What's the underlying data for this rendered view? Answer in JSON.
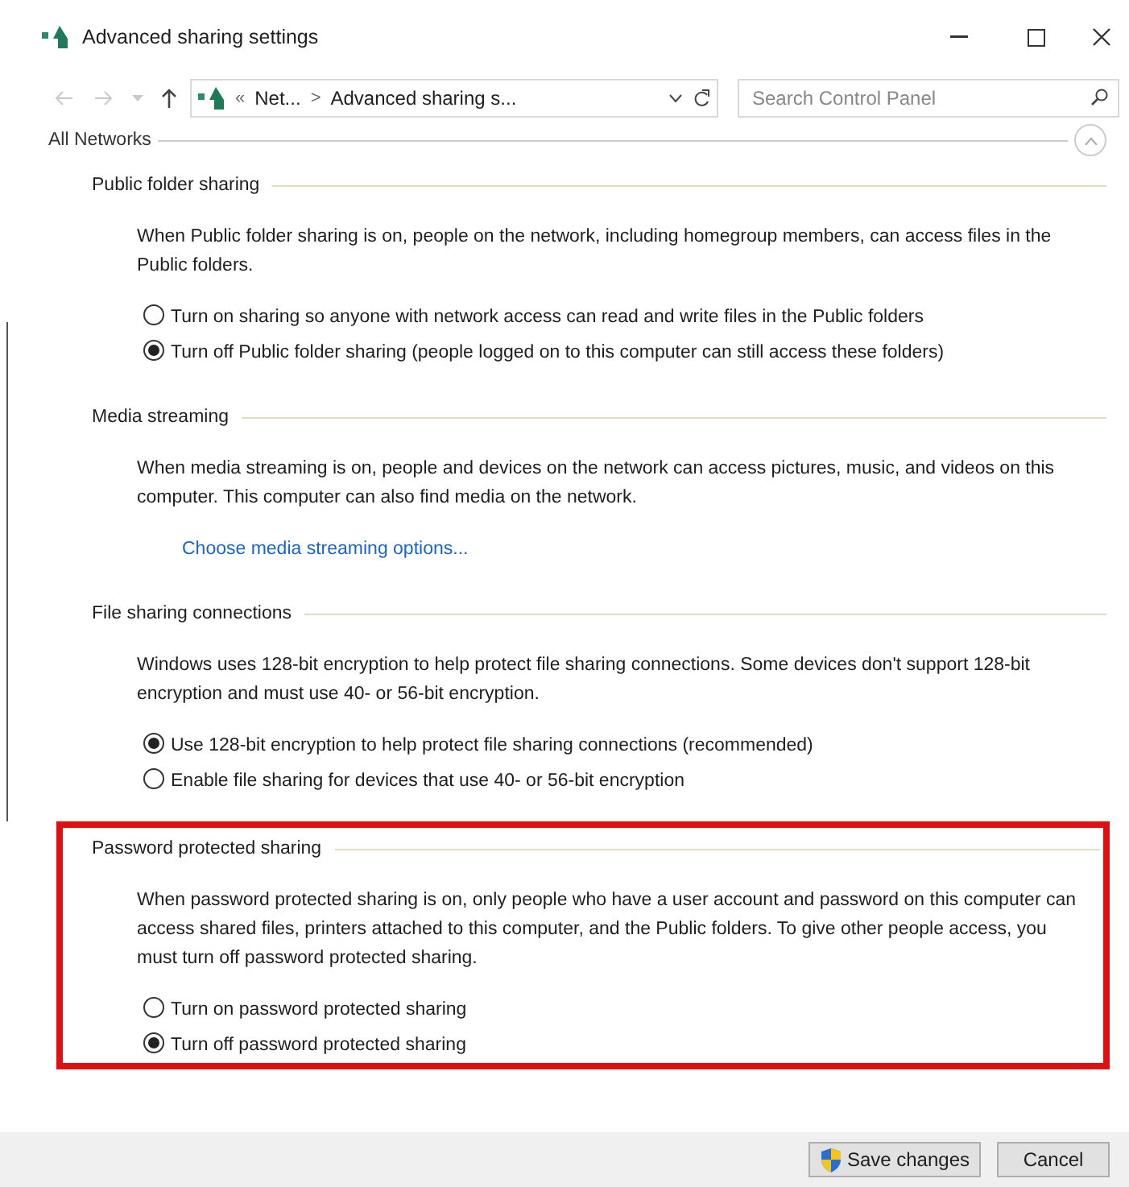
{
  "window": {
    "title": "Advanced sharing settings"
  },
  "address_bar": {
    "overflow": "«",
    "crumbs": [
      "Net...",
      "Advanced sharing s..."
    ],
    "separator": ">"
  },
  "search": {
    "placeholder": "Search Control Panel"
  },
  "group": {
    "title": "All Networks",
    "expanded": true
  },
  "sections": [
    {
      "title": "Public folder sharing",
      "highlighted": false,
      "items": [
        {
          "kind": "text",
          "text": "When Public folder sharing is on, people on the network, including homegroup members, can access files in the Public folders."
        },
        {
          "kind": "radios",
          "options": [
            {
              "label": "Turn on sharing so anyone with network access can read and write files in the Public folders",
              "selected": false
            },
            {
              "label": "Turn off Public folder sharing (people logged on to this computer can still access these folders)",
              "selected": true
            }
          ]
        }
      ]
    },
    {
      "title": "Media streaming",
      "highlighted": false,
      "items": [
        {
          "kind": "text",
          "text": "When media streaming is on, people and devices on the network can access pictures, music, and videos on this computer. This computer can also find media on the network."
        },
        {
          "kind": "link",
          "text": "Choose media streaming options..."
        }
      ]
    },
    {
      "title": "File sharing connections",
      "highlighted": false,
      "items": [
        {
          "kind": "text",
          "text": "Windows uses 128-bit encryption to help protect file sharing connections. Some devices don't support 128-bit encryption and must use 40- or 56-bit encryption."
        },
        {
          "kind": "radios",
          "options": [
            {
              "label": "Use 128-bit encryption to help protect file sharing connections (recommended)",
              "selected": true
            },
            {
              "label": "Enable file sharing for devices that use 40- or 56-bit encryption",
              "selected": false
            }
          ]
        }
      ]
    },
    {
      "title": "Password protected sharing",
      "highlighted": true,
      "items": [
        {
          "kind": "text",
          "text": "When password protected sharing is on, only people who have a user account and password on this computer can access shared files, printers attached to this computer, and the Public folders. To give other people access, you must turn off password protected sharing."
        },
        {
          "kind": "radios",
          "options": [
            {
              "label": "Turn on password protected sharing",
              "selected": false
            },
            {
              "label": "Turn off password protected sharing",
              "selected": true
            }
          ]
        }
      ]
    }
  ],
  "buttons": [
    {
      "label": "Save changes",
      "kind": "shield"
    },
    {
      "label": "Cancel",
      "kind": "plain"
    }
  ]
}
